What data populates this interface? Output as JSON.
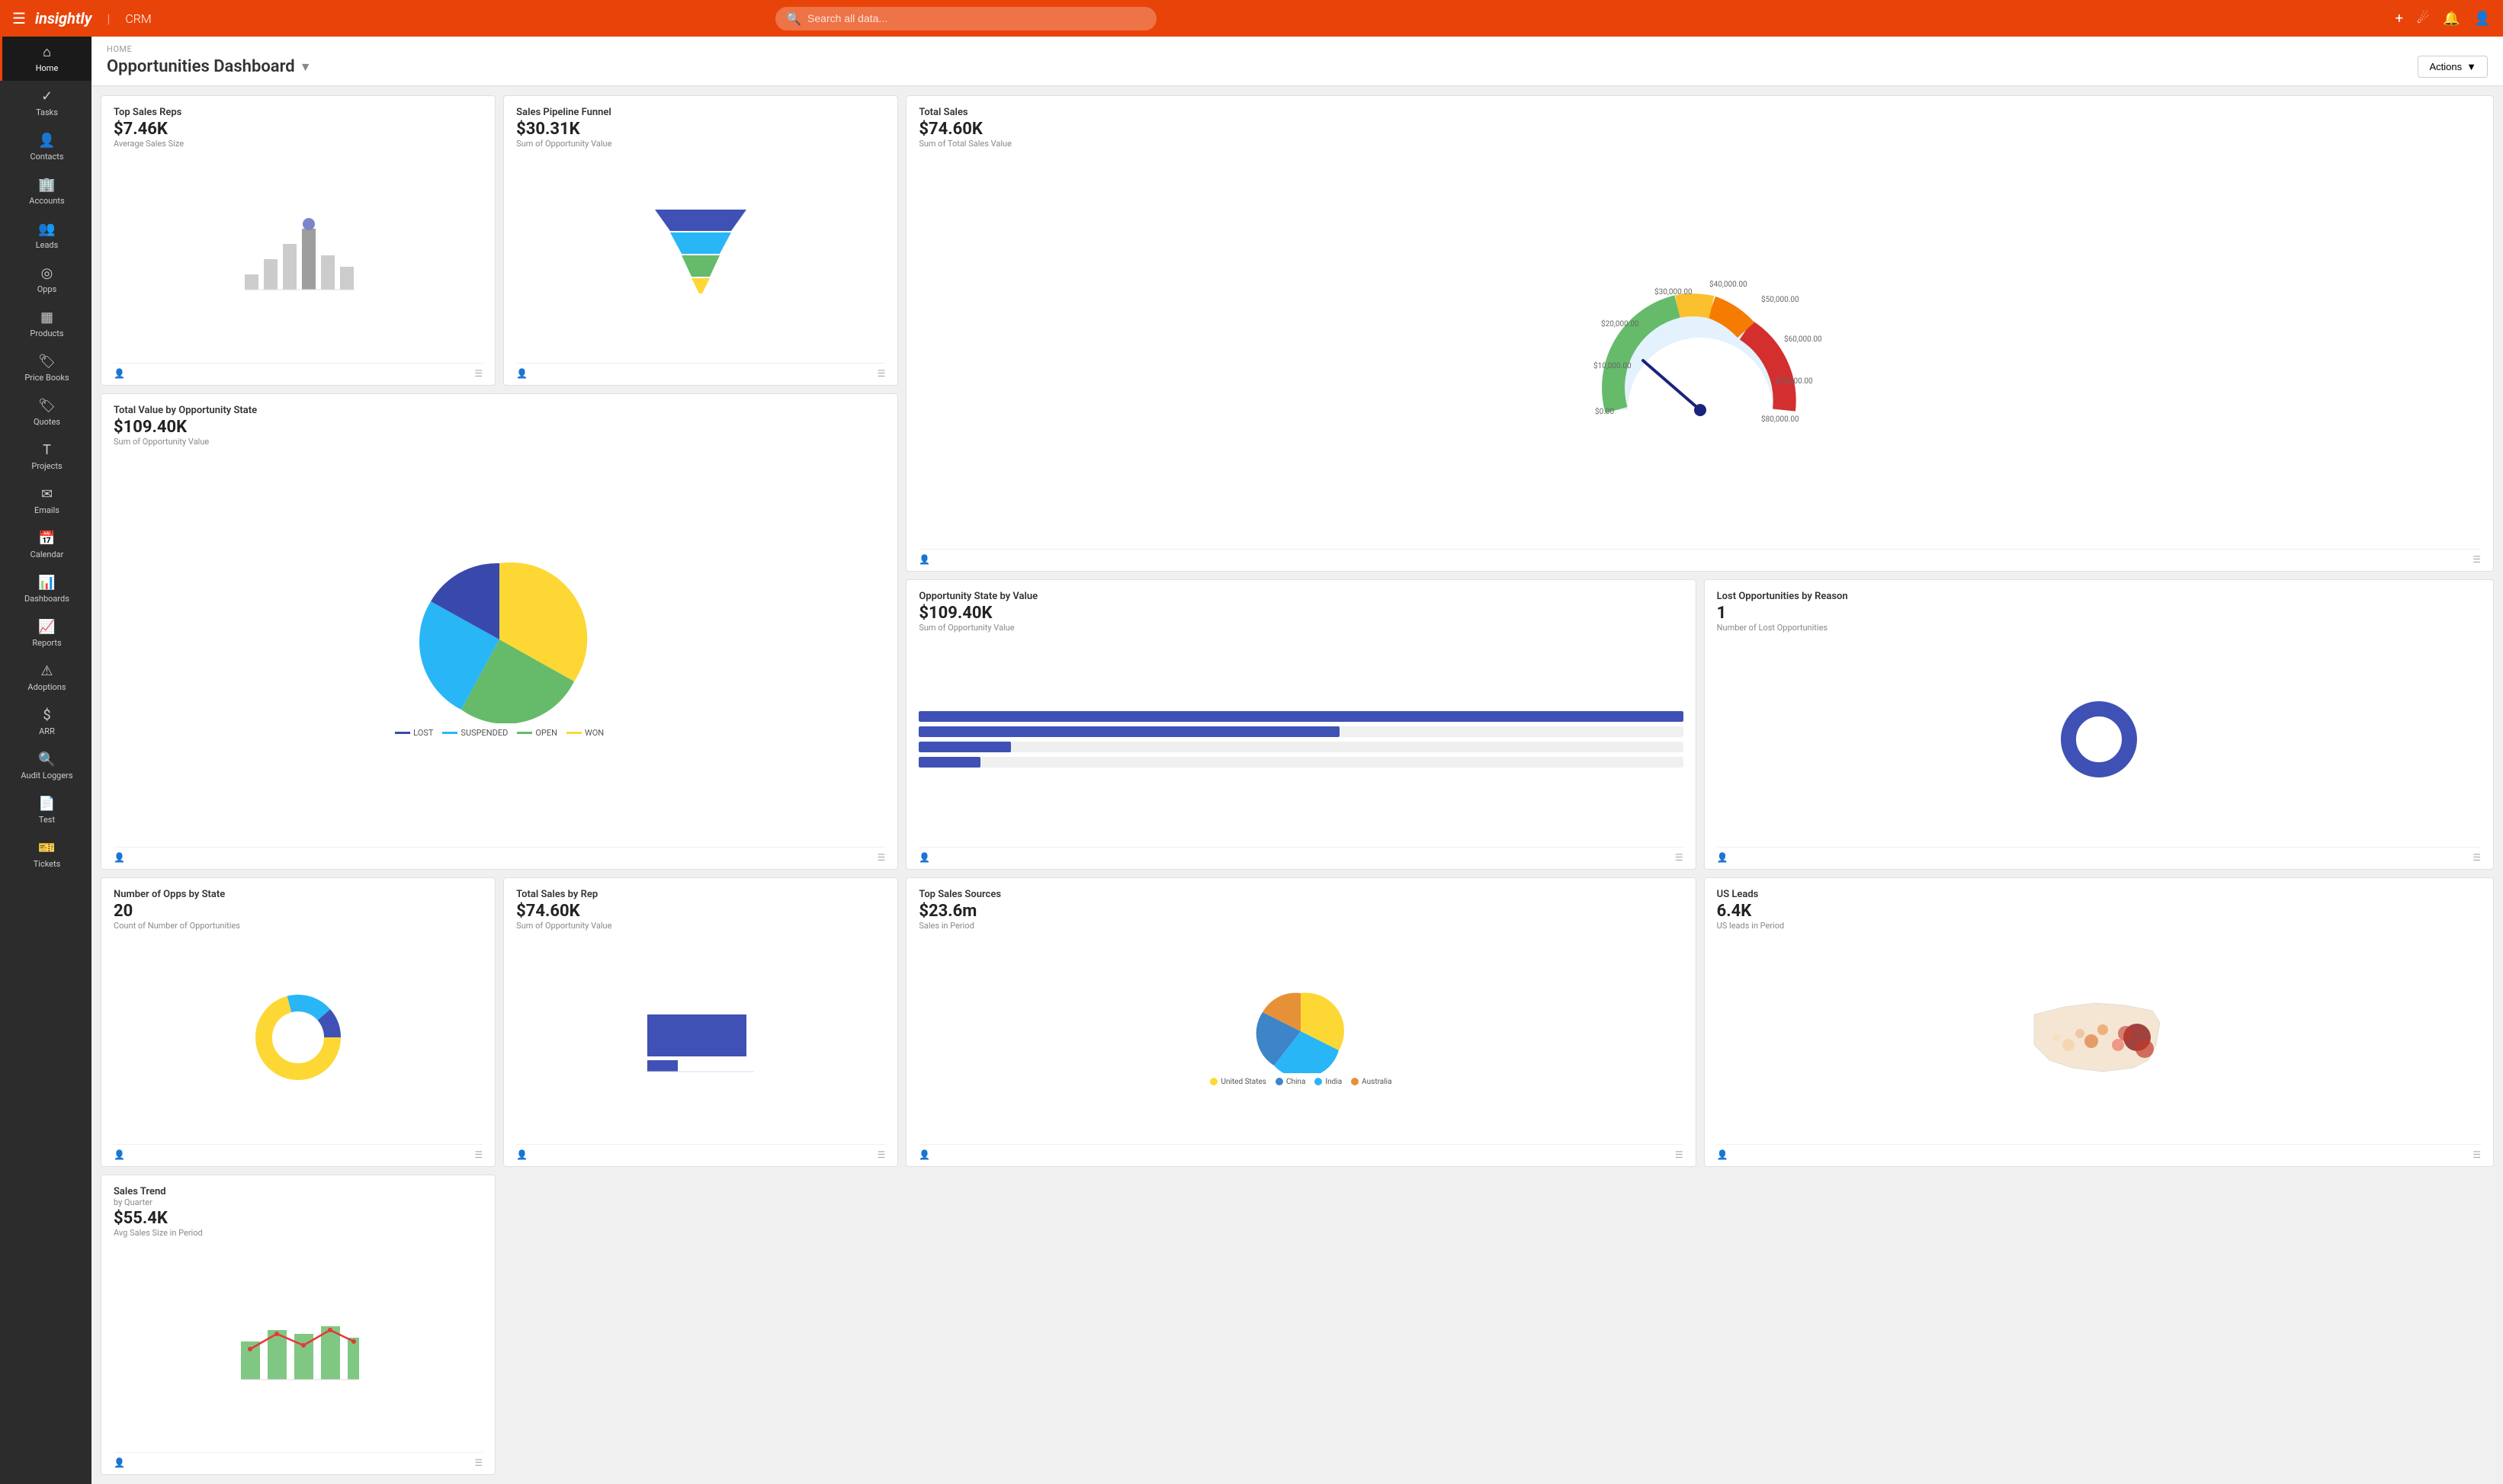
{
  "topNav": {
    "logo": "insightly",
    "divider": "|",
    "product": "CRM",
    "searchPlaceholder": "Search all data...",
    "icons": [
      "plus",
      "grid",
      "bell",
      "user"
    ]
  },
  "sidebar": {
    "items": [
      {
        "id": "home",
        "label": "Home",
        "icon": "⌂",
        "active": true
      },
      {
        "id": "tasks",
        "label": "Tasks",
        "icon": "✓"
      },
      {
        "id": "contacts",
        "label": "Contacts",
        "icon": "👤"
      },
      {
        "id": "accounts",
        "label": "Accounts",
        "icon": "🏢"
      },
      {
        "id": "leads",
        "label": "Leads",
        "icon": "👥"
      },
      {
        "id": "opps",
        "label": "Opps",
        "icon": "◎"
      },
      {
        "id": "products",
        "label": "Products",
        "icon": "▦"
      },
      {
        "id": "price-books",
        "label": "Price Books",
        "icon": "🏷"
      },
      {
        "id": "quotes",
        "label": "Quotes",
        "icon": "🏷"
      },
      {
        "id": "projects",
        "label": "Projects",
        "icon": "T"
      },
      {
        "id": "emails",
        "label": "Emails",
        "icon": "✉"
      },
      {
        "id": "calendar",
        "label": "Calendar",
        "icon": "📅"
      },
      {
        "id": "dashboards",
        "label": "Dashboards",
        "icon": "📊"
      },
      {
        "id": "reports",
        "label": "Reports",
        "icon": "📈"
      },
      {
        "id": "adoptions",
        "label": "Adoptions",
        "icon": "⚠"
      },
      {
        "id": "arr",
        "label": "ARR",
        "icon": "$"
      },
      {
        "id": "audit",
        "label": "Audit Loggers",
        "icon": "🔍"
      },
      {
        "id": "test",
        "label": "Test",
        "icon": "📄"
      },
      {
        "id": "tickets",
        "label": "Tickets",
        "icon": "🎫"
      }
    ]
  },
  "breadcrumb": "HOME",
  "pageTitle": "Opportunities Dashboard",
  "actionsLabel": "Actions",
  "cards": {
    "topSalesReps": {
      "title": "Top Sales Reps",
      "value": "$7.46K",
      "subtitle": "Average Sales Size"
    },
    "salesPipeline": {
      "title": "Sales Pipeline Funnel",
      "value": "$30.31K",
      "subtitle": "Sum of Opportunity Value"
    },
    "totalSales": {
      "title": "Total Sales",
      "value": "$74.60K",
      "subtitle": "Sum of Total Sales Value"
    },
    "totalValueByState": {
      "title": "Total Value by Opportunity State",
      "value": "$109.40K",
      "subtitle": "Sum of Opportunity Value"
    },
    "oppStateByValue": {
      "title": "Opportunity State by Value",
      "value": "$109.40K",
      "subtitle": "Sum of Opportunity Value"
    },
    "lostOpps": {
      "title": "Lost Opportunities by Reason",
      "value": "1",
      "subtitle": "Number of Lost Opportunities"
    },
    "numOppsByState": {
      "title": "Number of Opps by State",
      "value": "20",
      "subtitle": "Count of Number of Opportunities"
    },
    "totalSalesByRep": {
      "title": "Total Sales by Rep",
      "value": "$74.60K",
      "subtitle": "Sum of Opportunity Value"
    },
    "topSalesSources": {
      "title": "Top Sales Sources",
      "value": "$23.6m",
      "subtitle": "Sales in Period",
      "legend": [
        {
          "label": "United States",
          "color": "#f5c518"
        },
        {
          "label": "China",
          "color": "#3d85c8"
        },
        {
          "label": "India",
          "color": "#6aa84f"
        },
        {
          "label": "Australia",
          "color": "#e69138"
        }
      ]
    },
    "usLeads": {
      "title": "US Leads",
      "value": "6.4K",
      "subtitle": "US leads in Period"
    },
    "salesTrend": {
      "title": "Sales Trend",
      "titleSub": "by Quarter",
      "value": "$55.4K",
      "subtitle": "Avg Sales Size in Period"
    }
  },
  "gaugeLabels": [
    "$0.00",
    "$10,000.00",
    "$20,000.00",
    "$30,000.00",
    "$40,000.00",
    "$50,000.00",
    "$60,000.00",
    "$70,000.00",
    "$80,000.00"
  ],
  "pieLegend": [
    {
      "label": "LOST",
      "color": "#3949ab"
    },
    {
      "label": "SUSPENDED",
      "color": "#29b6f6"
    },
    {
      "label": "OPEN",
      "color": "#66bb6a"
    },
    {
      "label": "WON",
      "color": "#fdd835"
    }
  ]
}
